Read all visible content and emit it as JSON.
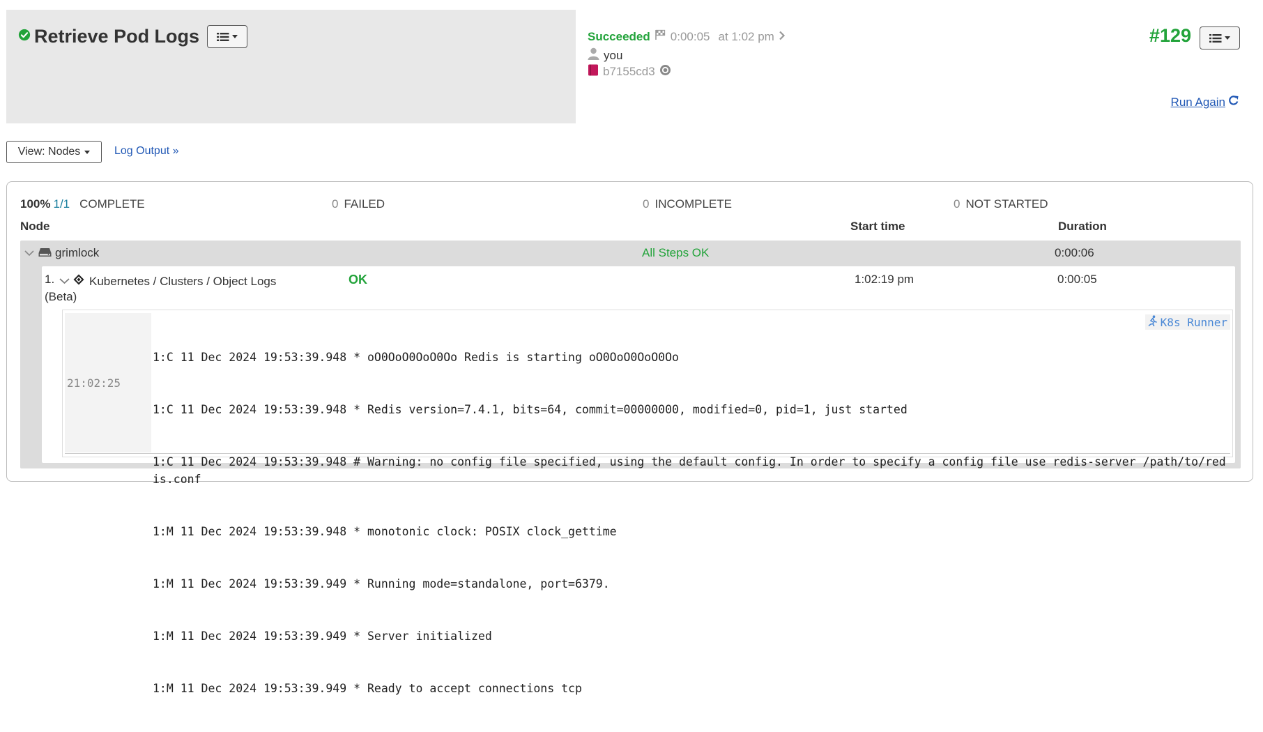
{
  "header": {
    "job_title": "Retrieve Pod Logs",
    "status": "Succeeded",
    "duration": "0:00:05",
    "time": "at 1:02 pm",
    "user": "you",
    "commit": "b7155cd3",
    "execution_number": "#129",
    "run_again_label": "Run Again"
  },
  "controls": {
    "view_label": "View: Nodes",
    "log_output_label": "Log Output »"
  },
  "summary": {
    "percent": "100%",
    "fraction": "1/1",
    "complete_label": "COMPLETE",
    "failed_count": "0",
    "failed_label": "FAILED",
    "incomplete_count": "0",
    "incomplete_label": "INCOMPLETE",
    "not_started_count": "0",
    "not_started_label": "NOT STARTED"
  },
  "columns": {
    "node": "Node",
    "start_time": "Start time",
    "duration": "Duration"
  },
  "node": {
    "name": "grimlock",
    "status": "All Steps OK",
    "duration": "0:00:06"
  },
  "step": {
    "number": "1.",
    "name_line1": "Kubernetes / Clusters / Object Logs",
    "name_line2": "(Beta)",
    "status": "OK",
    "start_time": "1:02:19 pm",
    "duration": "0:00:05"
  },
  "log": {
    "timestamp": "21:02:25",
    "runner_label": "K8s Runner",
    "lines": [
      "1:C 11 Dec 2024 19:53:39.948 * oO0OoO0OoO0Oo Redis is starting oO0OoO0OoO0Oo",
      "1:C 11 Dec 2024 19:53:39.948 * Redis version=7.4.1, bits=64, commit=00000000, modified=0, pid=1, just started",
      "1:C 11 Dec 2024 19:53:39.948 # Warning: no config file specified, using the default config. In order to specify a config file use redis-server /path/to/redis.conf",
      "1:M 11 Dec 2024 19:53:39.948 * monotonic clock: POSIX clock_gettime",
      "1:M 11 Dec 2024 19:53:39.949 * Running mode=standalone, port=6379.",
      "1:M 11 Dec 2024 19:53:39.949 * Server initialized",
      "1:M 11 Dec 2024 19:53:39.949 * Ready to accept connections tcp"
    ]
  },
  "colors": {
    "success": "#22a33a",
    "link": "#2158b5",
    "header_bg": "#e8e8e8"
  },
  "icons": {
    "status": "check-circle-icon",
    "menu": "list-icon",
    "finish": "checkered-flag-icon",
    "user": "user-icon",
    "commit": "book-icon",
    "run_again": "refresh-icon",
    "node": "server-icon",
    "step": "diamond-icon",
    "runner": "running-person-icon"
  }
}
